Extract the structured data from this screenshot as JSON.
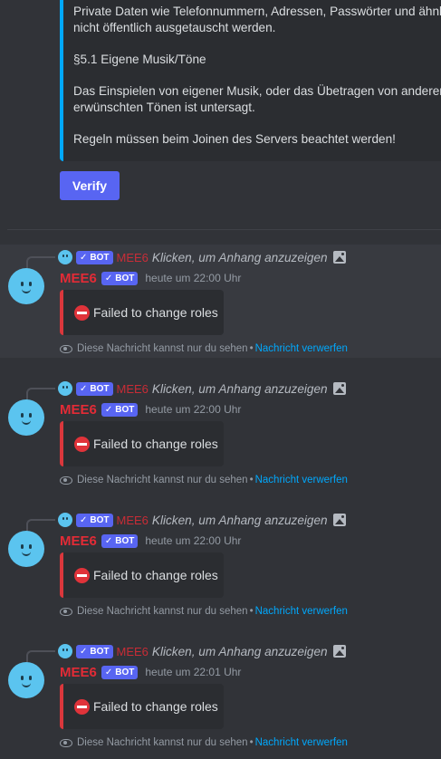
{
  "top_embed": {
    "lines": [
      "Private Daten wie Telefonnummern, Adressen, Passwörter und ähnlic",
      "nicht öffentlich ausgetauscht werden.",
      "§5.1 Eigene Musik/Töne",
      "Das Einspielen von eigener Musik, oder das Übetragen von anderen n",
      "erwünschten Tönen ist untersagt.",
      "Regeln müssen beim Joinen des Servers beachtet werden!"
    ],
    "accent_color": "#00a8fc"
  },
  "verify_button": {
    "label": "Verify"
  },
  "messages": [
    {
      "reply": {
        "bot_tag": "BOT",
        "author": "MEE6",
        "text": "Klicken, um Anhang anzuzeigen",
        "icon": "image-icon"
      },
      "author": "MEE6",
      "bot_tag": "BOT",
      "timestamp": "heute um 22:00 Uhr",
      "error_text": "Failed to change roles",
      "ephemeral_text": "Diese Nachricht kannst nur du sehen",
      "separator": "•",
      "dismiss_label": "Nachricht verwerfen",
      "highlighted": true
    },
    {
      "reply": {
        "bot_tag": "BOT",
        "author": "MEE6",
        "text": "Klicken, um Anhang anzuzeigen",
        "icon": "image-icon"
      },
      "author": "MEE6",
      "bot_tag": "BOT",
      "timestamp": "heute um 22:00 Uhr",
      "error_text": "Failed to change roles",
      "ephemeral_text": "Diese Nachricht kannst nur du sehen",
      "separator": "•",
      "dismiss_label": "Nachricht verwerfen",
      "highlighted": false
    },
    {
      "reply": {
        "bot_tag": "BOT",
        "author": "MEE6",
        "text": "Klicken, um Anhang anzuzeigen",
        "icon": "image-icon"
      },
      "author": "MEE6",
      "bot_tag": "BOT",
      "timestamp": "heute um 22:00 Uhr",
      "error_text": "Failed to change roles",
      "ephemeral_text": "Diese Nachricht kannst nur du sehen",
      "separator": "•",
      "dismiss_label": "Nachricht verwerfen",
      "highlighted": false
    },
    {
      "reply": {
        "bot_tag": "BOT",
        "author": "MEE6",
        "text": "Klicken, um Anhang anzuzeigen",
        "icon": "image-icon"
      },
      "author": "MEE6",
      "bot_tag": "BOT",
      "timestamp": "heute um 22:01 Uhr",
      "error_text": "Failed to change roles",
      "ephemeral_text": "Diese Nachricht kannst nur du sehen",
      "separator": "•",
      "dismiss_label": "Nachricht verwerfen",
      "highlighted": false
    }
  ],
  "colors": {
    "background": "#313338",
    "author": "#e32b36",
    "bot_tag": "#5865f2",
    "link": "#00a8fc",
    "error_accent": "#da373c"
  }
}
